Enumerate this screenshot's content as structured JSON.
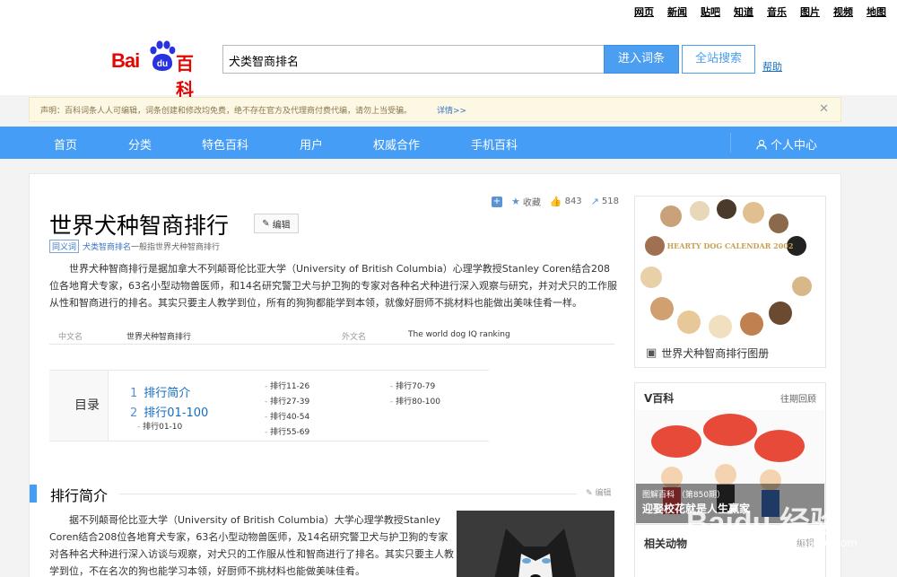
{
  "top_links": [
    "网页",
    "新闻",
    "贴吧",
    "知道",
    "音乐",
    "图片",
    "视频",
    "地图"
  ],
  "logo": {
    "bai": "Bai",
    "du": "du",
    "baike": "百科"
  },
  "search": {
    "value": "犬类智商排名",
    "enter_label": "进入词条",
    "all_label": "全站搜索",
    "help": "帮助"
  },
  "notice": {
    "text": "声明：百科词条人人可编辑，词条创建和修改均免费，绝不存在官方及代理商付费代编，请勿上当受骗。",
    "more": "详情>>",
    "close": "✕"
  },
  "nav": {
    "items": [
      "首页",
      "分类",
      "特色百科",
      "用户",
      "权威合作",
      "手机百科"
    ],
    "user": "个人中心"
  },
  "actions": {
    "collect": "收藏",
    "likes": "843",
    "shares": "518"
  },
  "title": "世界犬种智商排行",
  "edit_label": "编辑",
  "synonym": {
    "tag": "同义词",
    "link": "犬类智商排名",
    "rest": "一般指世界犬种智商排行"
  },
  "summary": "世界犬种智商排行是据加拿大不列颠哥伦比亚大学（University of British Columbia）心理学教授Stanley Coren结合208位各地育犬专家，63名小型动物兽医师，和14名研究警卫犬与护卫狗的专家对各种名犬种进行深入观察与研究，并对犬只的工作服从性和智商进行的排名。其实只要主人教学到位，所有的狗狗都能学到本领，就像好厨师不挑材料也能做出美味佳肴一样。",
  "basic_info": {
    "k1": "中文名",
    "v1": "世界犬种智商排行",
    "k2": "外文名",
    "v2": "The world dog IQ ranking"
  },
  "catalog": {
    "head": "目录",
    "items": [
      {
        "num": "1",
        "label": "排行简介"
      },
      {
        "num": "2",
        "label": "排行01-100"
      }
    ],
    "subitems": [
      "排行01-10",
      "排行11-26",
      "排行27-39",
      "排行40-54",
      "排行55-69",
      "排行70-79",
      "排行80-100"
    ]
  },
  "section": {
    "title": "排行简介",
    "edit": "编辑"
  },
  "section_text": "据不列颠哥伦比亚大学（University of British Columbia）大学心理学教授Stanley Coren结合208位各地育犬专家，63名小型动物兽医师，及14名研究警卫犬与护卫狗的专家对各种名犬种进行深入访谈与观察，对犬只的工作服从性和智商进行了排名。其实只要主人教学到位，不在名次的狗也能学习本领，好厨师不挑材料也能做美味佳肴。",
  "album": {
    "caption": "世界犬种智商排行图册",
    "calendar_text": "HEARTY DOG CALENDAR 2002"
  },
  "vbaike": {
    "title": "V百科",
    "more": "往期回顾",
    "tag": "图解百科",
    "count": "（第850期）",
    "headline": "迎娶校花就是人生赢家"
  },
  "related": {
    "title": "相关动物",
    "edit": "编辑"
  },
  "watermark": {
    "text": "Baidu 经验",
    "url": "jingyan.baidu.com"
  }
}
